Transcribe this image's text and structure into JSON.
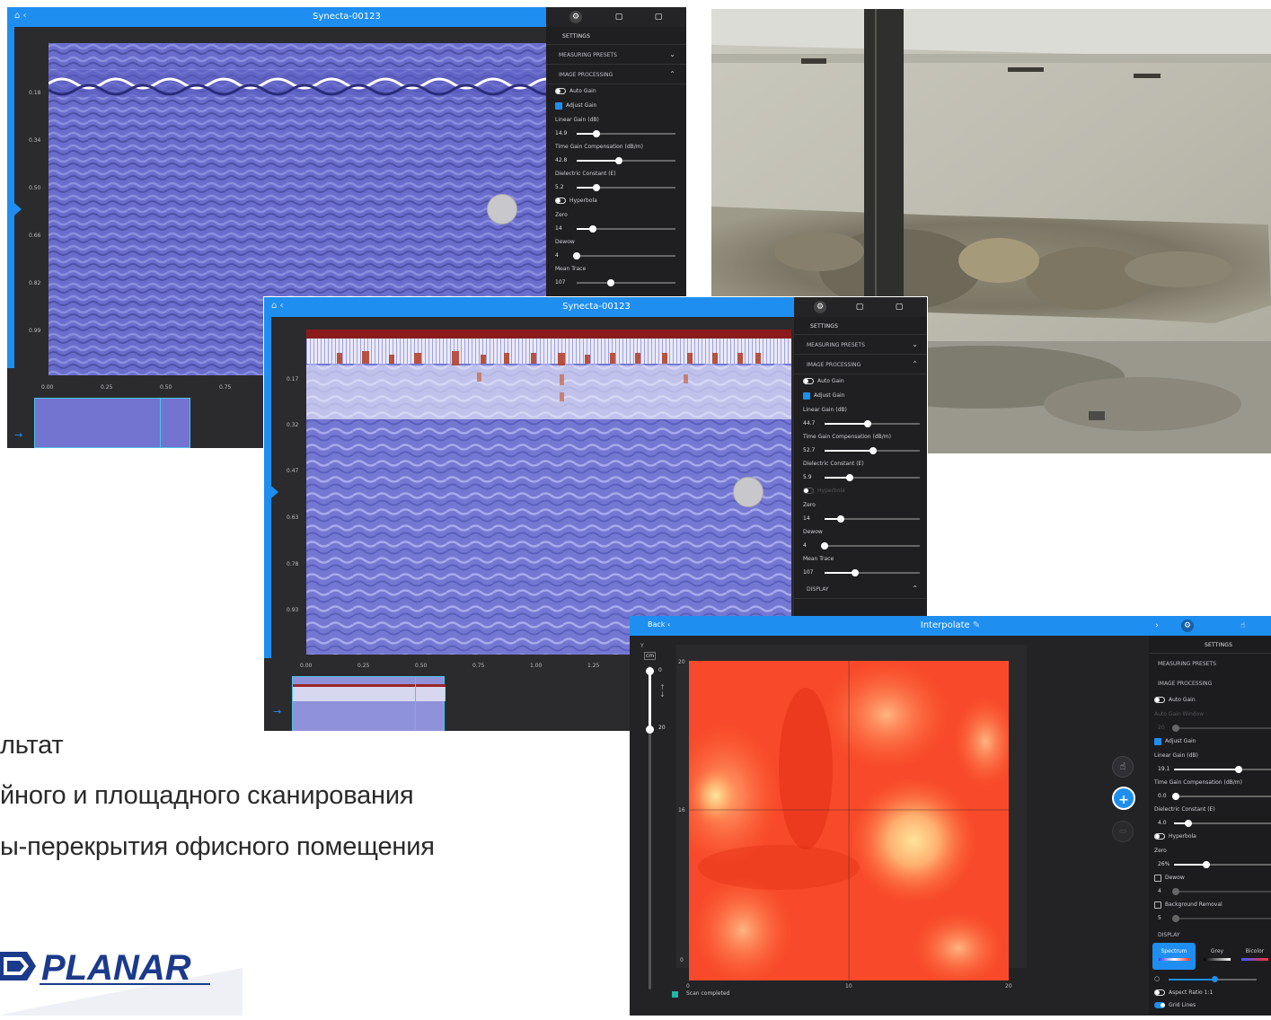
{
  "caption": {
    "line1": "льтат",
    "line2": "йного и площадного сканирования",
    "line3": "ы-перекрытия офисного помещения"
  },
  "logo": {
    "text": "PLANAR",
    "color": "#1b3a8c"
  },
  "window1": {
    "title": "Synecta-00123",
    "sidebar": {
      "header": "SETTINGS",
      "measuring_presets": "MEASURING PRESETS",
      "image_processing": "IMAGE PROCESSING",
      "auto_gain": "Auto Gain",
      "adjust_gain": "Adjust Gain",
      "linear_gain_label": "Linear Gain (dB)",
      "linear_gain_value": "14.9",
      "tgc_label": "Time Gain Compensation (dB/m)",
      "tgc_value": "42.8",
      "dielectric_label": "Dielectric Constant (E)",
      "dielectric_value": "5.2",
      "hyperbola": "Hyperbola",
      "zero_label": "Zero",
      "zero_value": "14",
      "dewow_label": "Dewow",
      "dewow_value": "4",
      "mean_trace_label": "Mean Trace",
      "mean_trace_value": "107"
    },
    "yticks": [
      "0.18",
      "0.34",
      "0.50",
      "0.66",
      "0.82",
      "0.99"
    ],
    "xticks": [
      "0.00",
      "0.25",
      "0.50",
      "0.75"
    ]
  },
  "window2": {
    "title": "Synecta-00123",
    "sidebar": {
      "header": "SETTINGS",
      "measuring_presets": "MEASURING PRESETS",
      "image_processing": "IMAGE PROCESSING",
      "auto_gain": "Auto Gain",
      "adjust_gain": "Adjust Gain",
      "linear_gain_label": "Linear Gain (dB)",
      "linear_gain_value": "44.7",
      "tgc_label": "Time Gain Compensation (dB/m)",
      "tgc_value": "52.7",
      "dielectric_label": "Dielectric Constant (E)",
      "dielectric_value": "5.9",
      "hyperbola": "Hyperbola",
      "zero_label": "Zero",
      "zero_value": "14",
      "dewow_label": "Dewow",
      "dewow_value": "4",
      "mean_trace_label": "Mean Trace",
      "mean_trace_value": "107",
      "display": "DISPLAY"
    },
    "yticks": [
      "0.17",
      "0.32",
      "0.47",
      "0.63",
      "0.78",
      "0.93"
    ],
    "xticks": [
      "0.00",
      "0.25",
      "0.50",
      "0.75",
      "1.00",
      "1.25"
    ]
  },
  "window3": {
    "title": "Interpolate",
    "back": "Back",
    "status": "Scan completed",
    "depth_unit": "cm",
    "depth_top": "0",
    "depth_bottom": "20",
    "yaxis_label": "Y",
    "yticks": [
      "20",
      "16",
      "0"
    ],
    "xticks": [
      "0",
      "10",
      "20"
    ],
    "sidebar": {
      "header": "SETTINGS",
      "measuring_presets": "MEASURING PRESETS",
      "image_processing": "IMAGE PROCESSING",
      "auto_gain": "Auto Gain",
      "auto_gain_window": "Auto Gain Window",
      "auto_gain_window_value": "20",
      "adjust_gain": "Adjust Gain",
      "linear_gain_label": "Linear Gain (dB)",
      "linear_gain_value": "19.1",
      "tgc_label": "Time Gain Compensation (dB/m)",
      "tgc_value": "0.0",
      "dielectric_label": "Dielectric Constant (E)",
      "dielectric_value": "4.0",
      "hyperbola": "Hyperbola",
      "zero_label": "Zero",
      "zero_value": "26%",
      "dewow": "Dewow",
      "dewow_value": "4",
      "background_removal": "Background Removal",
      "background_removal_value": "5",
      "display": "DISPLAY",
      "palette_spectrum": "Spectrum",
      "palette_grey": "Grey",
      "palette_bicolor": "Bicolor",
      "aspect_ratio": "Aspect Ratio 1:1",
      "grid_lines": "Grid Lines"
    }
  }
}
